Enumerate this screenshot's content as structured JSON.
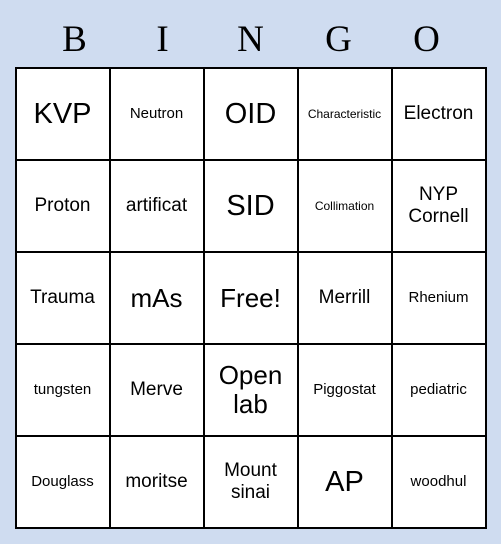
{
  "card": {
    "headers": [
      "B",
      "I",
      "N",
      "G",
      "O"
    ],
    "rows": [
      [
        {
          "text": "KVP",
          "size": "t-xl"
        },
        {
          "text": "Neutron",
          "size": "t-sm"
        },
        {
          "text": "OID",
          "size": "t-xl"
        },
        {
          "text": "Characteristic",
          "size": "t-xs"
        },
        {
          "text": "Electron",
          "size": "t-md"
        }
      ],
      [
        {
          "text": "Proton",
          "size": "t-md"
        },
        {
          "text": "artificat",
          "size": "t-md"
        },
        {
          "text": "SID",
          "size": "t-xl"
        },
        {
          "text": "Collimation",
          "size": "t-xs"
        },
        {
          "text": "NYP Cornell",
          "size": "t-md"
        }
      ],
      [
        {
          "text": "Trauma",
          "size": "t-md"
        },
        {
          "text": "mAs",
          "size": "t-lg"
        },
        {
          "text": "Free!",
          "size": "t-lg"
        },
        {
          "text": "Merrill",
          "size": "t-md"
        },
        {
          "text": "Rhenium",
          "size": "t-sm"
        }
      ],
      [
        {
          "text": "tungsten",
          "size": "t-sm"
        },
        {
          "text": "Merve",
          "size": "t-md"
        },
        {
          "text": "Open lab",
          "size": "t-lg"
        },
        {
          "text": "Piggostat",
          "size": "t-sm"
        },
        {
          "text": "pediatric",
          "size": "t-sm"
        }
      ],
      [
        {
          "text": "Douglass",
          "size": "t-sm"
        },
        {
          "text": "moritse",
          "size": "t-md"
        },
        {
          "text": "Mount sinai",
          "size": "t-md"
        },
        {
          "text": "AP",
          "size": "t-xl"
        },
        {
          "text": "woodhul",
          "size": "t-sm"
        }
      ]
    ]
  }
}
